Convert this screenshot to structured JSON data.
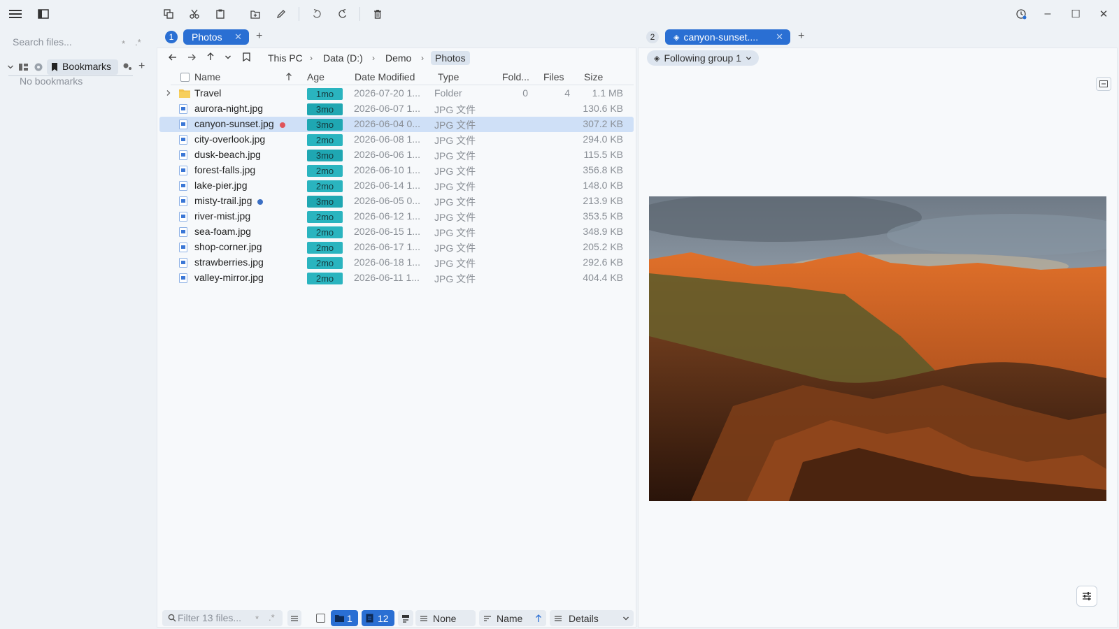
{
  "window": {
    "menu_icon": "hamburger-icon",
    "minimize": "–",
    "maximize": "☐",
    "close": "✕"
  },
  "sidebar": {
    "search_placeholder": "Search files...",
    "wildcard": "*",
    "regex": ".*",
    "bookmarks_label": "Bookmarks",
    "empty_text": "No bookmarks",
    "add": "+"
  },
  "left_pane": {
    "tab_number": "1",
    "tab_label": "Photos",
    "breadcrumbs": [
      "This PC",
      "Data (D:)",
      "Demo",
      "Photos"
    ],
    "columns": {
      "name": "Name",
      "age": "Age",
      "date": "Date Modified",
      "type": "Type",
      "folders": "Fold...",
      "files": "Files",
      "size": "Size"
    },
    "rows": [
      {
        "name": "Travel",
        "age": "1mo",
        "date": "2026-07-20 1...",
        "type": "Folder",
        "folders": "0",
        "files": "4",
        "size": "1.1 MB",
        "kind": "folder"
      },
      {
        "name": "aurora-night.jpg",
        "age": "3mo",
        "date": "2026-06-07 1...",
        "type": "JPG 文件",
        "folders": "",
        "files": "",
        "size": "130.6 KB",
        "kind": "file"
      },
      {
        "name": "canyon-sunset.jpg",
        "age": "3mo",
        "date": "2026-06-04 0...",
        "type": "JPG 文件",
        "folders": "",
        "files": "",
        "size": "307.2 KB",
        "kind": "file",
        "selected": true,
        "tag": "#e0545a"
      },
      {
        "name": "city-overlook.jpg",
        "age": "2mo",
        "date": "2026-06-08 1...",
        "type": "JPG 文件",
        "folders": "",
        "files": "",
        "size": "294.0 KB",
        "kind": "file"
      },
      {
        "name": "dusk-beach.jpg",
        "age": "3mo",
        "date": "2026-06-06 1...",
        "type": "JPG 文件",
        "folders": "",
        "files": "",
        "size": "115.5 KB",
        "kind": "file"
      },
      {
        "name": "forest-falls.jpg",
        "age": "2mo",
        "date": "2026-06-10 1...",
        "type": "JPG 文件",
        "folders": "",
        "files": "",
        "size": "356.8 KB",
        "kind": "file"
      },
      {
        "name": "lake-pier.jpg",
        "age": "2mo",
        "date": "2026-06-14 1...",
        "type": "JPG 文件",
        "folders": "",
        "files": "",
        "size": "148.0 KB",
        "kind": "file"
      },
      {
        "name": "misty-trail.jpg",
        "age": "3mo",
        "date": "2026-06-05 0...",
        "type": "JPG 文件",
        "folders": "",
        "files": "",
        "size": "213.9 KB",
        "kind": "file",
        "tag": "#3b6fc4"
      },
      {
        "name": "river-mist.jpg",
        "age": "2mo",
        "date": "2026-06-12 1...",
        "type": "JPG 文件",
        "folders": "",
        "files": "",
        "size": "353.5 KB",
        "kind": "file"
      },
      {
        "name": "sea-foam.jpg",
        "age": "2mo",
        "date": "2026-06-15 1...",
        "type": "JPG 文件",
        "folders": "",
        "files": "",
        "size": "348.9 KB",
        "kind": "file"
      },
      {
        "name": "shop-corner.jpg",
        "age": "2mo",
        "date": "2026-06-17 1...",
        "type": "JPG 文件",
        "folders": "",
        "files": "",
        "size": "205.2 KB",
        "kind": "file"
      },
      {
        "name": "strawberries.jpg",
        "age": "2mo",
        "date": "2026-06-18 1...",
        "type": "JPG 文件",
        "folders": "",
        "files": "",
        "size": "292.6 KB",
        "kind": "file"
      },
      {
        "name": "valley-mirror.jpg",
        "age": "2mo",
        "date": "2026-06-11 1...",
        "type": "JPG 文件",
        "folders": "",
        "files": "",
        "size": "404.4 KB",
        "kind": "file"
      }
    ],
    "statusbar": {
      "filter_placeholder": "Filter 13 files...",
      "wildcard": "*",
      "regex": ".*",
      "folders_count": "1",
      "files_count": "12",
      "group_label": "None",
      "sort_label": "Name",
      "view_label": "Details"
    }
  },
  "right_pane": {
    "tab_number": "2",
    "tab_label": "canyon-sunset....",
    "follow_label": "Following group 1",
    "preview_alt": "canyon sunset photo preview"
  }
}
